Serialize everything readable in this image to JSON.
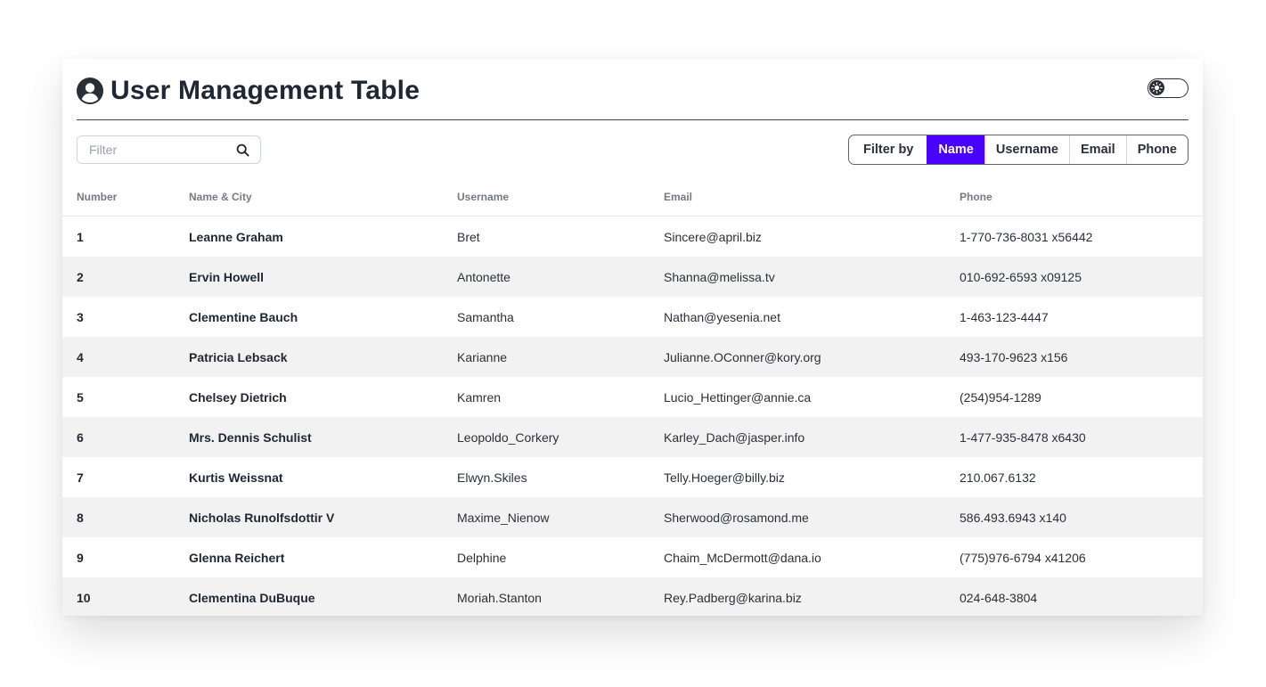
{
  "header": {
    "title": "User Management Table",
    "icon": "user-circle-icon",
    "theme_toggle_icon": "sun-icon"
  },
  "search": {
    "placeholder": "Filter",
    "value": "",
    "icon": "search-icon"
  },
  "filter": {
    "label": "Filter by",
    "options": [
      "Name",
      "Username",
      "Email",
      "Phone"
    ],
    "selected": "Name"
  },
  "colors": {
    "accent": "#4a00ff",
    "row_alt": "#f2f2f2"
  },
  "table": {
    "columns": [
      "Number",
      "Name & City",
      "Username",
      "Email",
      "Phone"
    ],
    "rows": [
      {
        "number": "1",
        "name": "Leanne Graham",
        "username": "Bret",
        "email": "Sincere@april.biz",
        "phone": "1-770-736-8031 x56442"
      },
      {
        "number": "2",
        "name": "Ervin Howell",
        "username": "Antonette",
        "email": "Shanna@melissa.tv",
        "phone": "010-692-6593 x09125"
      },
      {
        "number": "3",
        "name": "Clementine Bauch",
        "username": "Samantha",
        "email": "Nathan@yesenia.net",
        "phone": "1-463-123-4447"
      },
      {
        "number": "4",
        "name": "Patricia Lebsack",
        "username": "Karianne",
        "email": "Julianne.OConner@kory.org",
        "phone": "493-170-9623 x156"
      },
      {
        "number": "5",
        "name": "Chelsey Dietrich",
        "username": "Kamren",
        "email": "Lucio_Hettinger@annie.ca",
        "phone": "(254)954-1289"
      },
      {
        "number": "6",
        "name": "Mrs. Dennis Schulist",
        "username": "Leopoldo_Corkery",
        "email": "Karley_Dach@jasper.info",
        "phone": "1-477-935-8478 x6430"
      },
      {
        "number": "7",
        "name": "Kurtis Weissnat",
        "username": "Elwyn.Skiles",
        "email": "Telly.Hoeger@billy.biz",
        "phone": "210.067.6132"
      },
      {
        "number": "8",
        "name": "Nicholas Runolfsdottir V",
        "username": "Maxime_Nienow",
        "email": "Sherwood@rosamond.me",
        "phone": "586.493.6943 x140"
      },
      {
        "number": "9",
        "name": "Glenna Reichert",
        "username": "Delphine",
        "email": "Chaim_McDermott@dana.io",
        "phone": "(775)976-6794 x41206"
      },
      {
        "number": "10",
        "name": "Clementina DuBuque",
        "username": "Moriah.Stanton",
        "email": "Rey.Padberg@karina.biz",
        "phone": "024-648-3804"
      }
    ]
  }
}
